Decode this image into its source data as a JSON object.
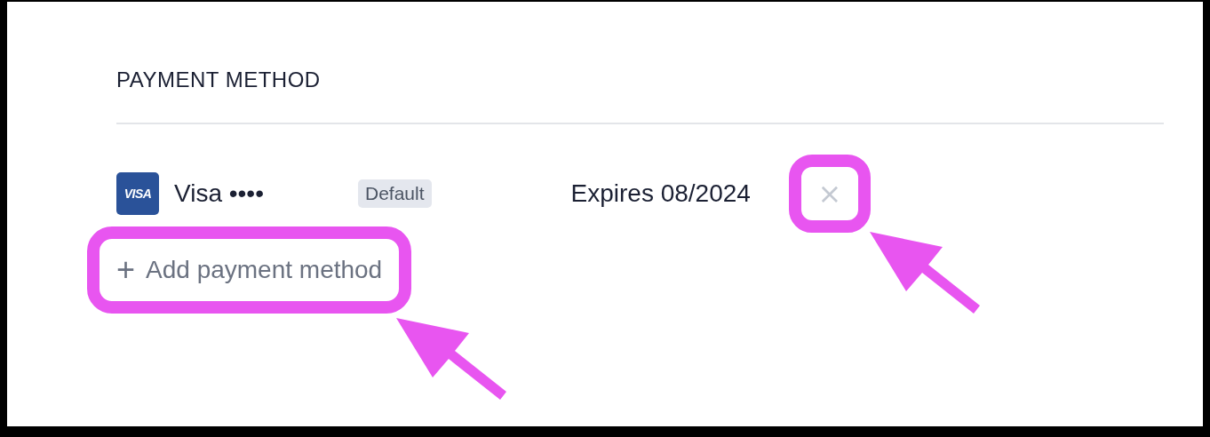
{
  "section": {
    "title": "PAYMENT METHOD"
  },
  "payment_methods": [
    {
      "logo": "VISA",
      "name": "Visa ••••",
      "badge": "Default",
      "expires": "Expires 08/2024",
      "remove": {
        "label": "×",
        "highlighted": true
      }
    }
  ],
  "add_button": {
    "icon": "+",
    "label": "Add payment method",
    "highlighted": true
  }
}
